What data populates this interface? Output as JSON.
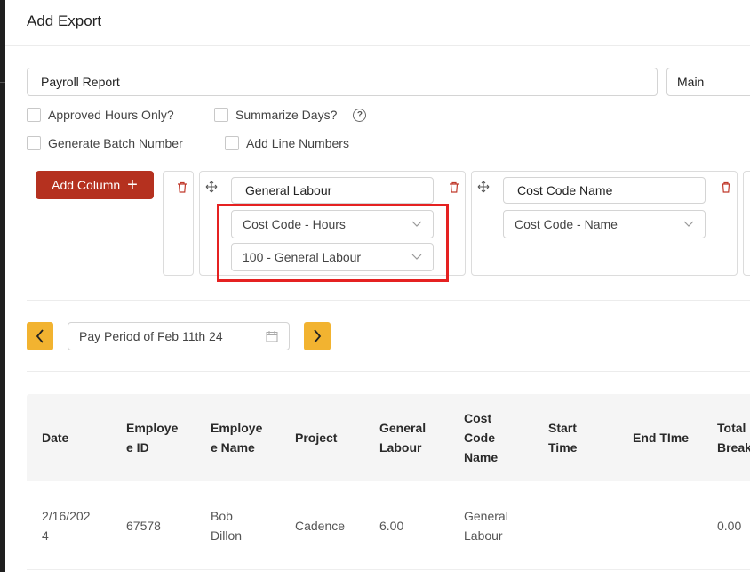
{
  "dialog": {
    "title": "Add Export"
  },
  "form": {
    "export_name": "Payroll Report",
    "view_select": "Main",
    "approved_hours_label": "Approved Hours Only?",
    "summarize_days_label": "Summarize Days?",
    "help_glyph": "?",
    "batch_number_label": "Generate Batch Number",
    "line_numbers_label": "Add Line Numbers"
  },
  "columns": {
    "add_button_label": "Add Column",
    "add_button_glyph": "+",
    "items": [
      {
        "name": "General Labour",
        "type": "Cost Code - Hours",
        "filter": "100 - General Labour"
      },
      {
        "name": "Cost Code Name",
        "type": "Cost Code - Name"
      }
    ]
  },
  "pay_period": {
    "label": "Pay Period of Feb 11th 24"
  },
  "colors": {
    "accent": "#b5311f",
    "nav": "#f2b330",
    "highlight": "#e52121"
  },
  "table": {
    "headers": [
      "Date",
      "Employee ID",
      "Employee Name",
      "Project",
      "General Labour",
      "Cost Code Name",
      "Start Time",
      "End TIme",
      "Total Break"
    ],
    "rows": [
      [
        "2/16/2024",
        "67578",
        "Bob Dillon",
        "Cadence",
        "6.00",
        "General Labour",
        "",
        "",
        "0.00"
      ]
    ]
  }
}
